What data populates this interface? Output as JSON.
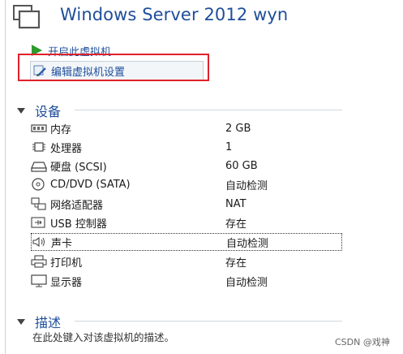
{
  "header": {
    "title": "Windows Server 2012 wyn",
    "icon": "vm-window-icon"
  },
  "actions": {
    "power_on": {
      "label": "开启此虚拟机",
      "icon": "play-icon"
    },
    "edit_settings": {
      "label": "编辑虚拟机设置",
      "icon": "edit-settings-icon"
    }
  },
  "devices": {
    "title": "设备",
    "items": [
      {
        "name": "内存",
        "value": "2 GB",
        "icon": "memory-icon"
      },
      {
        "name": "处理器",
        "value": "1",
        "icon": "processor-icon"
      },
      {
        "name": "硬盘 (SCSI)",
        "value": "60 GB",
        "icon": "hard-disk-icon"
      },
      {
        "name": "CD/DVD (SATA)",
        "value": "自动检测",
        "icon": "cd-dvd-icon"
      },
      {
        "name": "网络适配器",
        "value": "NAT",
        "icon": "network-adapter-icon"
      },
      {
        "name": "USB 控制器",
        "value": "存在",
        "icon": "usb-icon"
      },
      {
        "name": "声卡",
        "value": "自动检测",
        "icon": "speaker-icon"
      },
      {
        "name": "打印机",
        "value": "存在",
        "icon": "printer-icon"
      },
      {
        "name": "显示器",
        "value": "自动检测",
        "icon": "display-icon"
      }
    ]
  },
  "description": {
    "title": "描述",
    "placeholder": "在此处键入对该虚拟机的描述。"
  },
  "watermark": "CSDN @戏神",
  "colors": {
    "link_blue": "#1f4e9a",
    "highlight_red": "#e0212b",
    "play_green": "#2e9a2e"
  }
}
